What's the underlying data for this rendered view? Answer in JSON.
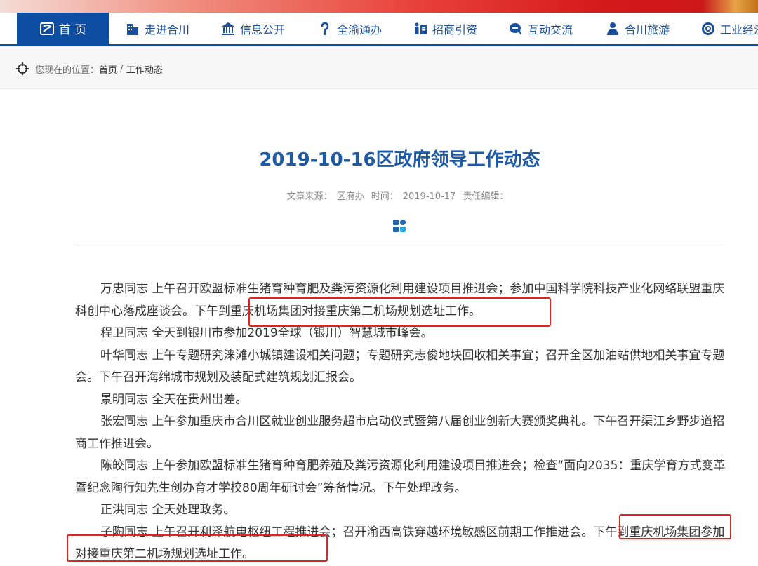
{
  "nav": {
    "items": [
      {
        "label": "首 页",
        "icon": "home-icon"
      },
      {
        "label": "走进合川",
        "icon": "building-icon"
      },
      {
        "label": "信息公开",
        "icon": "government-icon"
      },
      {
        "label": "全渝通办",
        "icon": "service-icon"
      },
      {
        "label": "招商引资",
        "icon": "investment-icon"
      },
      {
        "label": "互动交流",
        "icon": "chat-icon"
      },
      {
        "label": "合川旅游",
        "icon": "tourism-icon"
      },
      {
        "label": "工业经济",
        "icon": "industry-icon"
      }
    ]
  },
  "breadcrumb": {
    "prefix": "您现在的位置：",
    "home": "首页",
    "separator": " / ",
    "current": "工作动态"
  },
  "article": {
    "title": "2019-10-16区政府领导工作动态",
    "source_label": "文章来源：",
    "source": "区府办",
    "time_label": "时间：",
    "time": "2019-10-17",
    "editor_label": "责任编辑：",
    "paragraphs": [
      "万忠同志 上午召开欧盟标准生猪育种育肥及粪污资源化利用建设项目推进会；参加中国科学院科技产业化网络联盟重庆科创中心落成座谈会。下午到重庆机场集团对接重庆第二机场规划选址工作。",
      "程卫同志 全天到银川市参加2019全球（银川）智慧城市峰会。",
      "叶华同志 上午专题研究涞滩小城镇建设相关问题；专题研究志俊地块回收相关事宜；召开全区加油站供地相关事宜专题会。下午召开海绵城市规划及装配式建筑规划汇报会。",
      "景明同志 全天在贵州出差。",
      "张宏同志 上午参加重庆市合川区就业创业服务超市启动仪式暨第八届创业创新大赛颁奖典礼。下午召开渠江乡野步道招商工作推进会。",
      "陈皎同志 上午参加欧盟标准生猪育种育肥养殖及粪污资源化利用建设项目推进会；检查“面向2035：重庆学育方式变革暨纪念陶行知先生创办育才学校80周年研讨会”筹备情况。下午处理政务。",
      "正洪同志 全天处理政务。",
      "子陶同志 上午召开利泽航电枢纽工程推进会；召开渝西高铁穿越环境敏感区前期工作推进会。下午到重庆机场集团参加对接重庆第二机场规划选址工作。"
    ]
  },
  "colors": {
    "nav_active": "#0d4ea3",
    "title": "#1f5aa6",
    "highlight": "#e0241d"
  }
}
